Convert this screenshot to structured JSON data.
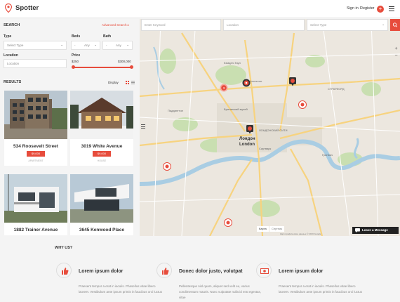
{
  "header": {
    "logo_text": "Spotter",
    "sign_in": "Sign in",
    "register": "Register",
    "plus": "+"
  },
  "sidebar": {
    "search_title": "SEARCH",
    "advanced_link": "Advanced Search ▸",
    "type_label": "Type",
    "type_value": "Select Type",
    "beds_label": "Beds",
    "beds_value": "-",
    "beds_any": "Any",
    "bath_label": "Bath",
    "bath_value": "-",
    "bath_any": "Any",
    "location_label": "Location",
    "location_placeholder": "Location",
    "price_label": "Price",
    "price_min": "$250",
    "price_max": "$300,000",
    "results_title": "RESULTS",
    "display_label": "Display"
  },
  "listings": [
    {
      "title": "534 Roosevelt Street",
      "price": "$9,000",
      "meta": "APARTMENT"
    },
    {
      "title": "3019 White Avenue",
      "price": "$9,000",
      "meta": "HOUSE"
    },
    {
      "title": "1882 Trainer Avenue",
      "price": "",
      "meta": ""
    },
    {
      "title": "3645 Kenwood Place",
      "price": "",
      "meta": ""
    }
  ],
  "map": {
    "keyword_placeholder": "Enter Keyword",
    "location_placeholder": "Location",
    "type_placeholder": "Select Type",
    "zoom_in": "+",
    "zoom_out": "−",
    "map_type_map": "Карта",
    "map_type_satellite": "Спутник",
    "city_label_ru": "Лондон",
    "city_label_en": "London",
    "attribution": "Картографические данные © 2016 Google",
    "cluster_count": "3",
    "place_labels": [
      "Кэмден-Таун",
      "Ислингтон",
      "СТРАТФОРД",
      "ЛОНДОНСКИЙ СИТИ",
      "Саутварк",
      "Гринвич",
      "Паддингтон",
      "Британский музей"
    ]
  },
  "leave_message": "Leave a Message",
  "why": {
    "title": "WHY US?",
    "features": [
      {
        "title": "Lorem ipsum dolor",
        "text": "Praesent tempor a erat in iaculis. Phasellus vitae libero laoreet. Vestibulum ante ipsum primis in faucibus orci luctus",
        "icon": "thumbs-up-icon"
      },
      {
        "title": "Donec dolor justo, volutpat",
        "text": "Pellentesque nisl quam, aliquet sed velit eu, varius condimentum mauris. Nunc vulputate nulla id erat egestas, vitae",
        "icon": "thumbs-up-icon"
      },
      {
        "title": "Lorem ipsum dolor",
        "text": "Praesent tempor a erat in iaculis. Phasellus vitae libero laoreet. Vestibulum ante ipsum primis in faucibus orci luctus",
        "icon": "money-icon"
      }
    ]
  },
  "colors": {
    "accent": "#e74c3c",
    "map_bg": "#ece7df",
    "water": "#a9cde3",
    "park": "#c9dfb1"
  }
}
